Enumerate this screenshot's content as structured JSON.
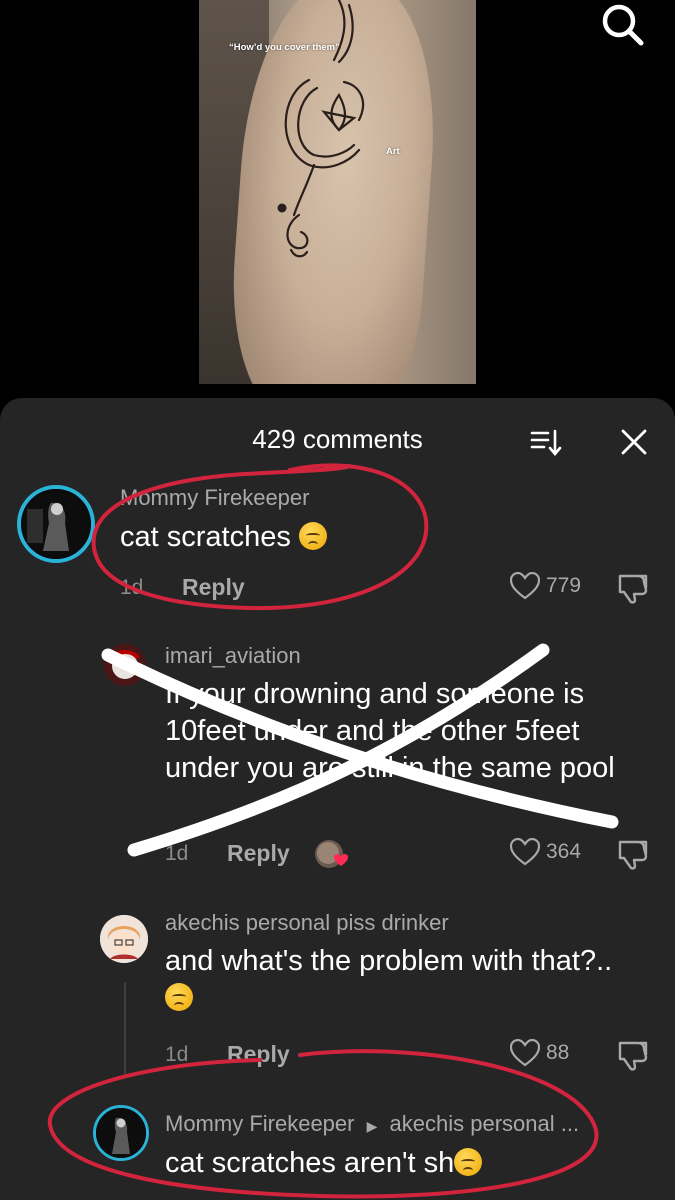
{
  "video": {
    "caption_question": "“How’d you cover them”",
    "caption_art": "Art"
  },
  "top_bar": {
    "search_icon": "search-icon"
  },
  "comments_header": {
    "count_label": "429 comments",
    "sort_icon": "sort-icon",
    "close_icon": "close-icon"
  },
  "comments": [
    {
      "username": "Mommy Firekeeper",
      "text": "cat scratches ",
      "emoji": "pleading-face",
      "time": "1d",
      "reply_label": "Reply",
      "likes": "779",
      "annotation": "circled-red"
    },
    {
      "username": "imari_aviation",
      "text": "If your drowning and someone is 10feet under and the other 5feet under you are still in the same pool",
      "time": "1d",
      "reply_label": "Reply",
      "likes": "364",
      "annotation": "crossed-out-white"
    },
    {
      "username": "akechis personal piss drinker",
      "text": "and what's the problem with that?.. ",
      "emoji": "pleading-face",
      "time": "1d",
      "reply_label": "Reply",
      "likes": "88"
    },
    {
      "username": "Mommy Firekeeper",
      "reply_to": "akechis personal ...",
      "text": "cat scratches aren't sh",
      "emoji": "pleading-face",
      "annotation": "circled-red"
    }
  ],
  "colors": {
    "sheet_bg": "#252525",
    "annotation_red": "#d2243d",
    "annotation_white": "#ffffff",
    "avatar_ring": "#2ab3d6"
  }
}
